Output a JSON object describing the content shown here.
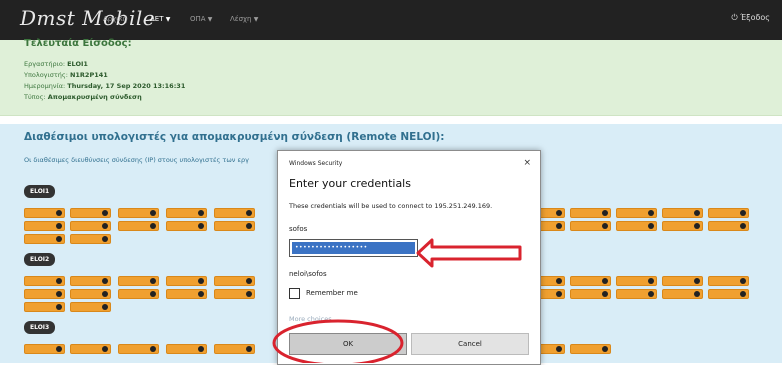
{
  "navbar": {
    "brand": "Dmst Mobile",
    "items": [
      {
        "label": "Αρχική"
      },
      {
        "label": "ΔΕΤ"
      },
      {
        "label": "ΟΠΑ"
      },
      {
        "label": "Λέσχη"
      }
    ],
    "logout": "Έξοδος",
    "logout_icon": "power-icon"
  },
  "last_login": {
    "title": "Τελευταία Είσοδος:",
    "lab_label": "Εργαστήριο:",
    "lab_value": "ELOI1",
    "computer_label": "Υπολογιστής:",
    "computer_value": "N1R2P141",
    "date_label": "Ημερομηνία:",
    "date_value": "Thursday, 17 Sep 2020 13:16:31",
    "type_label": "Τύπος:",
    "type_value": "Απομακρυσμένη σύνδεση"
  },
  "available": {
    "title": "Διαθέσιμοι υπολογιστές για απομακρυσμένη σύνδεση (Remote NELOI):",
    "subtitle": "Οι διαθέσιμες διευθύνσεις σύνδεσης (IP) στους υπολογιστές των εργ",
    "groups": [
      "ELOI1",
      "ELOI2",
      "ELOI3"
    ]
  },
  "dialog": {
    "header": "Windows Security",
    "close": "×",
    "title": "Enter your credentials",
    "description": "These credentials will be used to connect to 195.251.249.169.",
    "username": "sofos",
    "password_mask": "••••••••••••••••••",
    "domain_user": "neloi\\sofos",
    "remember": "Remember me",
    "remember_checked": false,
    "more_choices": "More choices",
    "ok": "OK",
    "cancel": "Cancel"
  },
  "colors": {
    "navbar": "#222222",
    "success_bg": "#dff0d8",
    "info_bg": "#d9edf7",
    "chip": "#f0a030",
    "annotation": "#d9232e"
  }
}
